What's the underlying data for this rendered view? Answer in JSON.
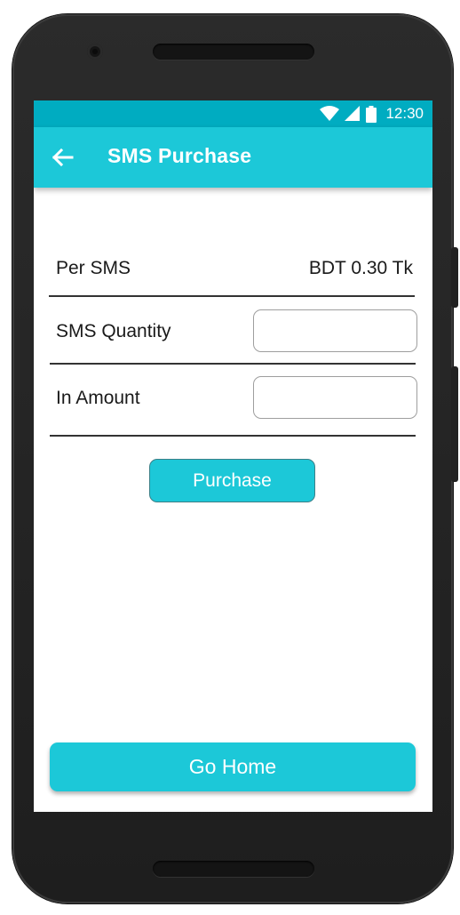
{
  "status_bar": {
    "time": "12:30",
    "icons": [
      "wifi-icon",
      "signal-icon",
      "battery-icon"
    ],
    "color": "#00acc1"
  },
  "app_bar": {
    "title": "SMS Purchase",
    "back_icon": "arrow-left-icon",
    "color": "#1cc8d8"
  },
  "form": {
    "per_sms_label": "Per SMS",
    "per_sms_value": "BDT 0.30 Tk",
    "quantity_label": "SMS Quantity",
    "quantity_value": "",
    "amount_label": "In Amount",
    "amount_value": ""
  },
  "buttons": {
    "purchase_label": "Purchase",
    "go_home_label": "Go Home"
  }
}
